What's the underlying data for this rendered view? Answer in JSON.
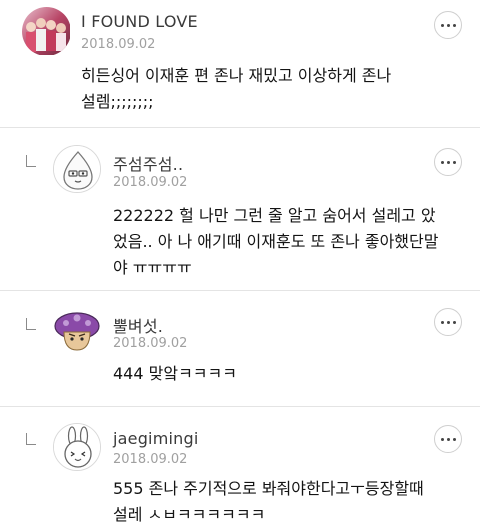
{
  "comments": [
    {
      "name": "I FOUND LOVE",
      "date": "2018.09.02",
      "body": "히든싱어 이재훈 편 존나 재밌고 이상하게 존나\n설렘;;;;;;;;"
    },
    {
      "name": "주섬주섬..",
      "date": "2018.09.02",
      "body": "222222 헐 나만 그런 줄 알고 숨어서 설레고 았\n었음.. 아 나 애기때 이재훈도 또 존나 좋아했단말\n야 ㅠㅠㅠㅠ"
    },
    {
      "name": "뿔벼섯.",
      "date": "2018.09.02",
      "body": "444 맞앜ㅋㅋㅋㅋ"
    },
    {
      "name": "jaegimingi",
      "date": "2018.09.02",
      "body": "555 존나 주기적으로 봐줘야한다고ㅜ등장할때\n설레 ㅅㅂㅋㅋㅋㅋㅋㅋ"
    }
  ],
  "icons": {
    "more": "more-horizontal-icon",
    "reply": "reply-indent-icon"
  }
}
